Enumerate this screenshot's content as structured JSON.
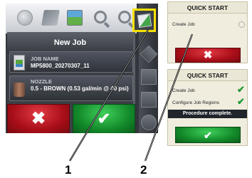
{
  "main_screen": {
    "panel_title": "New Job",
    "job": {
      "label": "JOB NAME",
      "value": "MP5800_20270307_11"
    },
    "nozzle": {
      "label": "NOZZLE",
      "value": "0.5 - BROWN (0.53 gal/min @ 40 psi)"
    },
    "cancel_glyph": "✖",
    "ok_glyph": "✔"
  },
  "quick_start_before": {
    "title": "QUICK START",
    "rows": [
      {
        "label": "Create Job",
        "status": "pending"
      }
    ],
    "cancel_glyph": "✖"
  },
  "quick_start_after": {
    "title": "QUICK START",
    "rows": [
      {
        "label": "Create Job",
        "status": "done",
        "glyph": "✔"
      },
      {
        "label": "Configure Job Regions",
        "status": "done",
        "glyph": "✔"
      }
    ],
    "message": "Procedure complete.",
    "ok_glyph": "✔"
  },
  "callouts": {
    "one": "1",
    "two": "2"
  },
  "colors": {
    "highlight": "#f7e100",
    "cancel": "#c8141e",
    "confirm": "#1f9a32"
  }
}
